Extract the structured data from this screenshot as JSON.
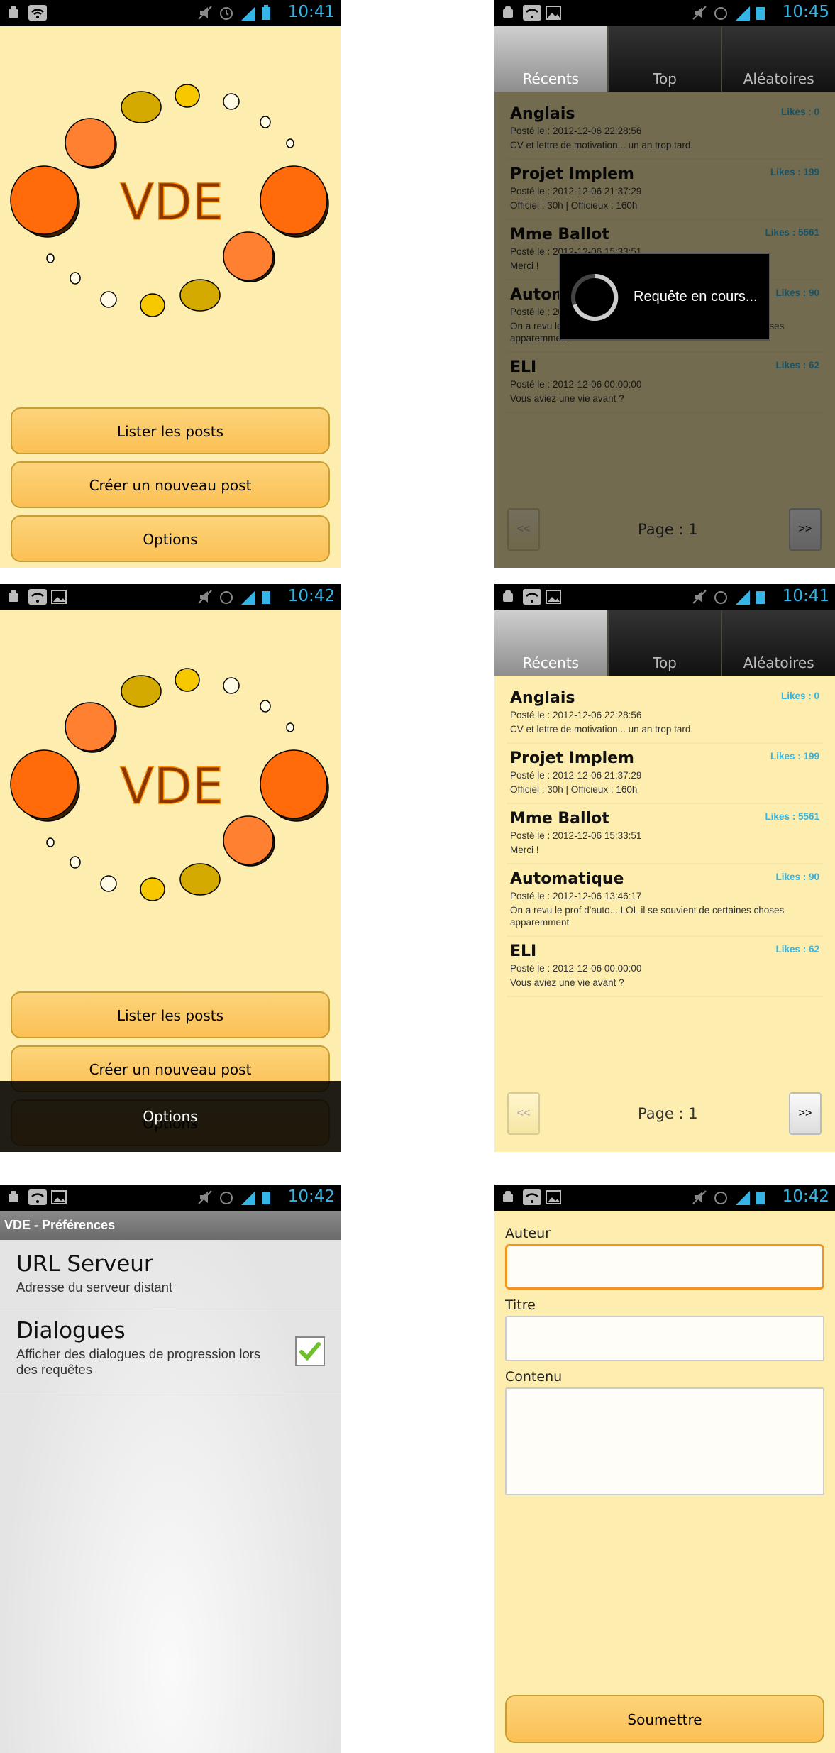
{
  "status_bars": [
    {
      "time": "10:41"
    },
    {
      "time": "10:45"
    },
    {
      "time": "10:42"
    },
    {
      "time": "10:41"
    },
    {
      "time": "10:42"
    },
    {
      "time": "10:42"
    }
  ],
  "home": {
    "logo_text": "VDE",
    "buttons": [
      "Lister les posts",
      "Créer un nouveau post",
      "Options"
    ]
  },
  "tabs": [
    "Récents",
    "Top",
    "Aléatoires"
  ],
  "posts": [
    {
      "title": "Anglais",
      "date": "Posté le : 2012-12-06 22:28:56",
      "content": "CV et lettre de motivation... un an trop tard.",
      "likes": "Likes : 0"
    },
    {
      "title": "Projet Implem",
      "date": "Posté le : 2012-12-06 21:37:29",
      "content": "Officiel : 30h | Officieux : 160h",
      "likes": "Likes : 199"
    },
    {
      "title": "Mme Ballot",
      "date": "Posté le : 2012-12-06 15:33:51",
      "content": "Merci !",
      "likes": "Likes : 5561"
    },
    {
      "title": "Automatique",
      "date": "Posté le : 2012-12-06 13:46:17",
      "content": "On a revu le prof d'auto... LOL il se souvient de certaines choses apparemment",
      "likes": "Likes : 90"
    },
    {
      "title": "ELI",
      "date": "Posté le : 2012-12-06 00:00:00",
      "content": "Vous aviez une vie avant ?",
      "likes": "Likes : 62"
    }
  ],
  "pager": {
    "prev": "<<",
    "next": ">>",
    "page": "Page : 1"
  },
  "loading": {
    "text": "Requête en cours..."
  },
  "prefs": {
    "title": "VDE - Préférences",
    "items": [
      {
        "title": "URL Serveur",
        "summary": "Adresse du serveur distant"
      },
      {
        "title": "Dialogues",
        "summary": "Afficher des dialogues de progression lors des requêtes",
        "checked": true
      }
    ]
  },
  "form": {
    "author_label": "Auteur",
    "title_label": "Titre",
    "content_label": "Contenu",
    "submit": "Soumettre"
  }
}
